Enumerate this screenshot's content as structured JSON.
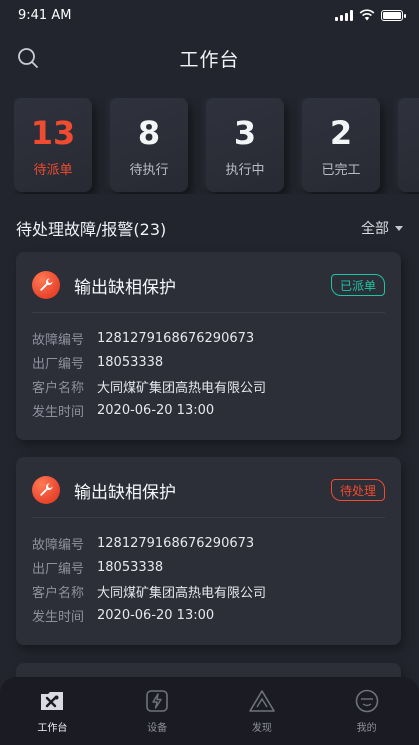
{
  "status_bar": {
    "time": "9:41 AM"
  },
  "header": {
    "title": "工作台"
  },
  "stats": [
    {
      "count": "13",
      "label": "待派单",
      "active": true
    },
    {
      "count": "8",
      "label": "待执行"
    },
    {
      "count": "3",
      "label": "执行中"
    },
    {
      "count": "2",
      "label": "已完工"
    }
  ],
  "section": {
    "title": "待处理故障/报警(23)",
    "filter_label": "全部"
  },
  "field_labels": {
    "fault_no": "故障编号",
    "factory_no": "出厂编号",
    "customer": "客户名称",
    "time": "发生时间"
  },
  "cards": [
    {
      "title": "输出缺相保护",
      "status": "已派单",
      "fault_no": "1281279168676290673",
      "factory_no": "18053338",
      "customer": "大同煤矿集团高热电有限公司",
      "time": "2020-06-20 13:00"
    },
    {
      "title": "输出缺相保护",
      "status": "待处理",
      "fault_no": "1281279168676290673",
      "factory_no": "18053338",
      "customer": "大同煤矿集团高热电有限公司",
      "time": "2020-06-20 13:00"
    }
  ],
  "tabs": [
    {
      "label": "工作台",
      "active": true
    },
    {
      "label": "设备"
    },
    {
      "label": "发现"
    },
    {
      "label": "我的"
    }
  ],
  "colors": {
    "accent": "#ef4b30",
    "success": "#1fc4a5",
    "background": "#23252e"
  }
}
